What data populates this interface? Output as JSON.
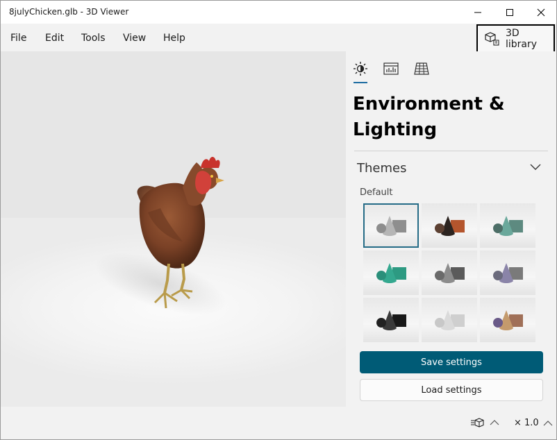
{
  "window": {
    "title": "8julyChicken.glb - 3D Viewer"
  },
  "menu": {
    "items": [
      "File",
      "Edit",
      "Tools",
      "View",
      "Help"
    ]
  },
  "library_button": {
    "label": "3D library"
  },
  "panel": {
    "tabs": [
      "sun-icon",
      "stats-icon",
      "grid-icon"
    ],
    "heading_line1": "Environment &",
    "heading_line2": "Lighting",
    "section": "Themes",
    "theme_label": "Default",
    "themes": [
      {
        "sphere": "#8d8d8d",
        "cone": "#b5b5b5",
        "cube": "#8e8e8e",
        "selected": true
      },
      {
        "sphere": "#5c4032",
        "cone": "#2c2420",
        "cube": "#b4552d",
        "selected": false
      },
      {
        "sphere": "#4d6e67",
        "cone": "#6aa89b",
        "cube": "#5d8a80",
        "selected": false
      },
      {
        "sphere": "#2a8f7a",
        "cone": "#34a88f",
        "cube": "#2d9a82",
        "selected": false
      },
      {
        "sphere": "#6a6a6a",
        "cone": "#8c8c8c",
        "cube": "#5a5a5a",
        "selected": false
      },
      {
        "sphere": "#6b6b7d",
        "cone": "#8a84a8",
        "cube": "#7a7a7a",
        "selected": false
      },
      {
        "sphere": "#222222",
        "cone": "#3a3a3a",
        "cube": "#181818",
        "selected": false
      },
      {
        "sphere": "#c8c8c8",
        "cone": "#dadada",
        "cube": "#cfcfcf",
        "selected": false
      },
      {
        "sphere": "#6a5a88",
        "cone": "#c49a6c",
        "cube": "#a07058",
        "selected": false
      }
    ],
    "save_label": "Save settings",
    "load_label": "Load settings"
  },
  "statusbar": {
    "zoom": "× 1.0"
  },
  "colors": {
    "accent": "#005b76",
    "selection": "#246b86"
  }
}
